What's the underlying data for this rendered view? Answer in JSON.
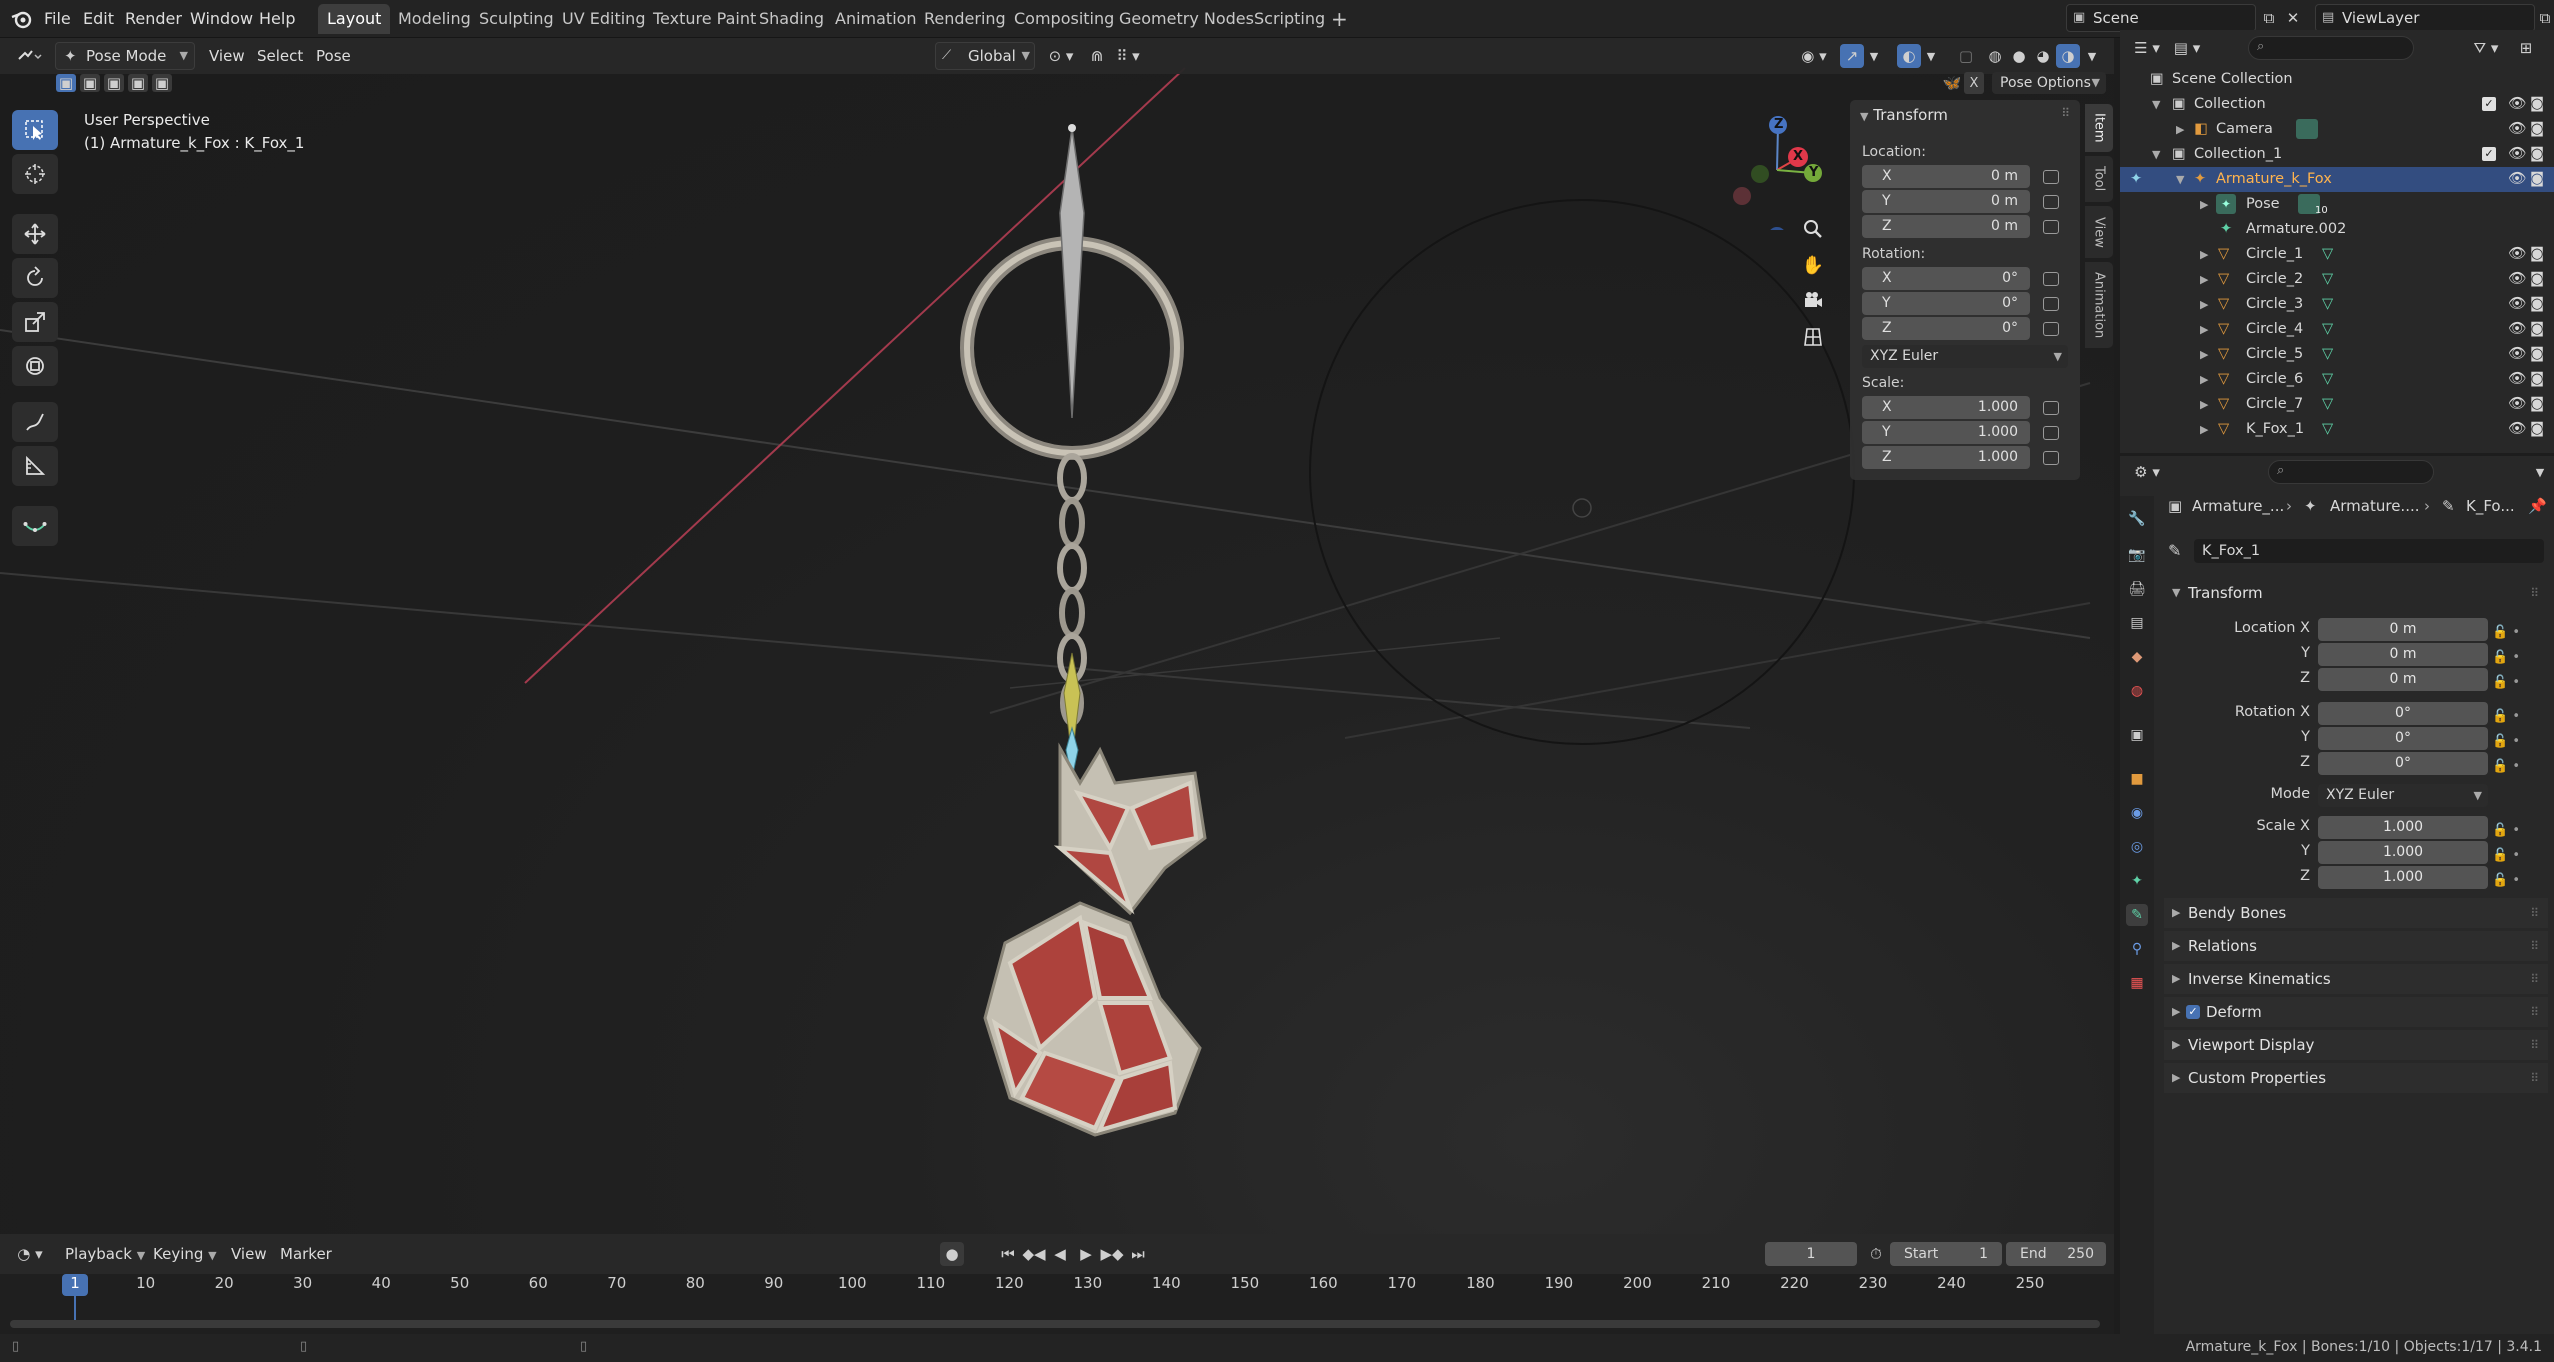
{
  "menus": [
    "File",
    "Edit",
    "Render",
    "Window",
    "Help"
  ],
  "workspaces": [
    "Layout",
    "Modeling",
    "Sculpting",
    "UV Editing",
    "Texture Paint",
    "Shading",
    "Animation",
    "Rendering",
    "Compositing",
    "Geometry Nodes",
    "Scripting"
  ],
  "workspace_add": "+",
  "scene": {
    "label": "Scene",
    "view_layer": "ViewLayer"
  },
  "viewport": {
    "mode": "Pose Mode",
    "menus": [
      "View",
      "Select",
      "Pose"
    ],
    "orientation": "Global",
    "pose_options": "Pose Options",
    "overlay_title": "User Perspective",
    "overlay_sub": "(1) Armature_k_Fox : K_Fox_1",
    "gizmo": {
      "x": "X",
      "y": "Y",
      "z": "Z"
    },
    "tabs": [
      "Item",
      "Tool",
      "View",
      "Animation"
    ],
    "tab_close": "X"
  },
  "npanel": {
    "title": "Transform",
    "location_label": "Location:",
    "location": [
      {
        "axis": "X",
        "value": "0 m"
      },
      {
        "axis": "Y",
        "value": "0 m"
      },
      {
        "axis": "Z",
        "value": "0 m"
      }
    ],
    "rotation_label": "Rotation:",
    "rotation": [
      {
        "axis": "X",
        "value": "0°"
      },
      {
        "axis": "Y",
        "value": "0°"
      },
      {
        "axis": "Z",
        "value": "0°"
      }
    ],
    "rotation_mode": "XYZ Euler",
    "scale_label": "Scale:",
    "scale": [
      {
        "axis": "X",
        "value": "1.000"
      },
      {
        "axis": "Y",
        "value": "1.000"
      },
      {
        "axis": "Z",
        "value": "1.000"
      }
    ]
  },
  "outliner": {
    "rows": [
      {
        "name": "Scene Collection"
      },
      {
        "name": "Collection"
      },
      {
        "name": "Camera"
      },
      {
        "name": "Collection_1"
      },
      {
        "name": "Armature_k_Fox"
      },
      {
        "name": "Pose"
      },
      {
        "name": "Armature.002"
      },
      {
        "name": "Circle_1"
      },
      {
        "name": "Circle_2"
      },
      {
        "name": "Circle_3"
      },
      {
        "name": "Circle_4"
      },
      {
        "name": "Circle_5"
      },
      {
        "name": "Circle_6"
      },
      {
        "name": "Circle_7"
      },
      {
        "name": "K_Fox_1"
      }
    ],
    "pose_badge": "10"
  },
  "properties": {
    "breadcrumb": [
      "Armature_...",
      "Armature....",
      "K_Fo..."
    ],
    "bone_name": "K_Fox_1",
    "transform_title": "Transform",
    "location_x_label": "Location X",
    "y_label": "Y",
    "z_label": "Z",
    "rotation_x_label": "Rotation X",
    "mode_label": "Mode",
    "scale_x_label": "Scale X",
    "location": [
      "0 m",
      "0 m",
      "0 m"
    ],
    "rotation": [
      "0°",
      "0°",
      "0°"
    ],
    "mode": "XYZ Euler",
    "scale": [
      "1.000",
      "1.000",
      "1.000"
    ],
    "sections": [
      "Bendy Bones",
      "Relations",
      "Inverse Kinematics",
      "Deform",
      "Viewport Display",
      "Custom Properties"
    ]
  },
  "timeline": {
    "menus": [
      "Playback",
      "Keying",
      "View",
      "Marker"
    ],
    "current_frame": "1",
    "start_label": "Start",
    "start": "1",
    "end_label": "End",
    "end": "250",
    "ticks": [
      "1",
      "10",
      "20",
      "30",
      "40",
      "50",
      "60",
      "70",
      "80",
      "90",
      "100",
      "110",
      "120",
      "130",
      "140",
      "150",
      "160",
      "170",
      "180",
      "190",
      "200",
      "210",
      "220",
      "230",
      "240",
      "250"
    ]
  },
  "status": {
    "text": "Armature_k_Fox | Bones:1/10 | Objects:1/17 | 3.4.1"
  }
}
